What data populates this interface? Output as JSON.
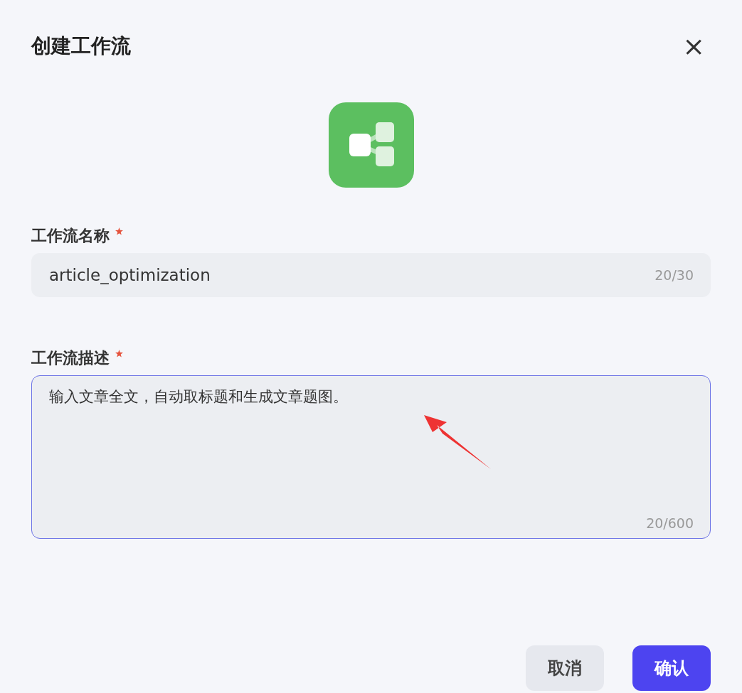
{
  "dialog": {
    "title": "创建工作流",
    "close_label": "×"
  },
  "fields": [
    {
      "kind": "input",
      "label": "工作流名称",
      "required": true,
      "value": "article_optimization",
      "counter": "20/30",
      "focused": false
    },
    {
      "kind": "textarea",
      "label": "工作流描述",
      "required": true,
      "value": "输入文章全文，自动取标题和生成文章题图。",
      "counter": "20/600",
      "focused": true
    }
  ],
  "buttons": [
    {
      "label": "取消",
      "kind": "secondary"
    },
    {
      "label": "确认",
      "kind": "primary"
    }
  ]
}
